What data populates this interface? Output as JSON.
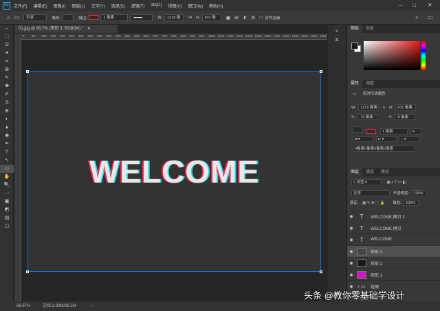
{
  "menu": {
    "items": [
      "文件(F)",
      "编辑(E)",
      "图像(I)",
      "图层(L)",
      "文字(Y)",
      "选择(S)",
      "滤镜(T)",
      "3D(D)",
      "视图(V)",
      "窗口(W)",
      "帮助(H)"
    ]
  },
  "options": {
    "mode": "形状",
    "fill_label": "填充:",
    "stroke_label": "描边:",
    "stroke_width": "1 像素",
    "w_label": "W:",
    "w_value": "1219 像",
    "h_label": "H:",
    "h_value": "831 像",
    "align_label": "对齐边缘"
  },
  "tools": [
    "↔",
    "⬚",
    "ʘ",
    "✦",
    "⌗",
    "⊠",
    "✎",
    "✚",
    "✐",
    "♙",
    "◈",
    "◐",
    "▲",
    "◉",
    "✒",
    "T",
    "↖",
    "▭",
    "✋",
    "🔍",
    "···",
    "▣",
    "◩",
    "▤",
    "▢"
  ],
  "document": {
    "tab_title": "01.jpg @ 66.7% (矩形 3, RGB/8#) *",
    "ruler": [
      "0",
      "50",
      "100",
      "150",
      "200",
      "250",
      "300",
      "350",
      "400",
      "450",
      "500",
      "550",
      "600",
      "650",
      "700",
      "750",
      "800",
      "850",
      "900",
      "950",
      "1000",
      "1050",
      "1100",
      "1150",
      "1200",
      "1250",
      "1300",
      "1350",
      "1400",
      "1450",
      "1500",
      "1550",
      "1600"
    ],
    "canvas_text": "WELCOME"
  },
  "status": {
    "zoom": "66.67%",
    "doc_info": "文档:2.80M/36.5M"
  },
  "color_panel": {
    "tabs": [
      "颜色",
      "色板"
    ]
  },
  "properties": {
    "tabs": [
      "属性",
      "调整"
    ],
    "title": "实时形状属性",
    "w_label": "W:",
    "w": "1219 像素",
    "h_label": "H:",
    "h": "831 像素",
    "x_label": "X:",
    "x": "-11 像素",
    "y_label": "Y:",
    "y": "-9 像素",
    "stroke": "1 像素",
    "corners": "0像素0像素0像素0像素"
  },
  "layers": {
    "tabs": [
      "图层",
      "通道",
      "路径"
    ],
    "filter": "类型",
    "blend": "正常",
    "opacity_label": "不透明度:",
    "opacity": "100%",
    "lock_label": "锁定:",
    "fill_label": "填充:",
    "fill": "100%",
    "items": [
      {
        "name": "WELCOME 拷贝 2",
        "kind": "text",
        "selected": false
      },
      {
        "name": "WELCOME 拷贝",
        "kind": "text",
        "selected": false
      },
      {
        "name": "WELCOME",
        "kind": "text",
        "selected": false
      },
      {
        "name": "矩形 3",
        "kind": "shape",
        "color": "#444444",
        "selected": true
      },
      {
        "name": "矩形 2",
        "kind": "shape",
        "color": "#1a1a1a",
        "selected": false
      },
      {
        "name": "矩形 1",
        "kind": "shape",
        "color": "#d414c8",
        "selected": false
      },
      {
        "name": "组图",
        "kind": "group",
        "selected": false
      }
    ]
  },
  "watermark": "头条 @教你零基础学设计",
  "colors": {
    "accent": "#1c6fd4",
    "stroke_red": "#e0282f",
    "bg_dark": "#262626",
    "panel": "#383838"
  }
}
